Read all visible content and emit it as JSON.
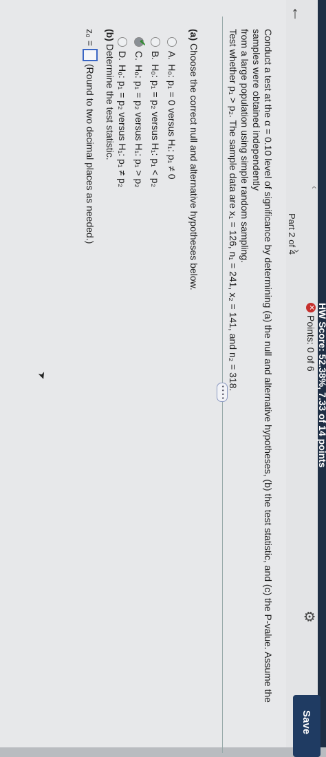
{
  "header": {
    "hw_score": "HW Score: 52.38%, 7.33 of 14 points",
    "points": "Points: 0 of 6",
    "part": "Part 2 of 4",
    "save_label": "Save",
    "prev_symbol": "‹",
    "next_symbol": "›",
    "back_symbol": "←",
    "points_icon": "x-circle-icon",
    "gear_icon": "gear-icon"
  },
  "question": {
    "line1": "Conduct a test at the α = 0.10 level of significance by determining (a) the null and alternative hypotheses, (b) the test statistic, and (c) the P-value. Assume the samples were obtained independently",
    "line2": "from a large population using simple random sampling.",
    "line3": "Test whether p₁ > p₂. The sample data are x₁ = 126, n₁ = 241, x₂ = 141, and n₂ = 318."
  },
  "more_label": "• • • •",
  "part_a": {
    "prompt_bold": "(a)",
    "prompt": " Choose the correct null and alternative hypotheses below.",
    "options": [
      {
        "letter": "A.",
        "text": "H₀: p₁ = 0 versus H₁: p₁ ≠ 0",
        "selected": false
      },
      {
        "letter": "B.",
        "text": "H₀: p₁ = p₂ versus H₁: p₁ < p₂",
        "selected": false
      },
      {
        "letter": "C.",
        "text": "H₀: p₁ = p₂ versus H₁: p₁ > p₂",
        "selected": true
      },
      {
        "letter": "D.",
        "text": "H₀: p₁ = p₂ versus H₁: p₁ ≠ p₂",
        "selected": false
      }
    ]
  },
  "part_b": {
    "prompt_bold": "(b)",
    "prompt": " Determine the test statistic.",
    "z_label": "z₀ =",
    "hint": "(Round to two decimal places as needed.)"
  },
  "colors": {
    "save_bg": "#1f3b62",
    "topbar_dark": "#1e2e44",
    "check_green": "#2e8a2e",
    "answer_box_border": "#3a66c4"
  }
}
